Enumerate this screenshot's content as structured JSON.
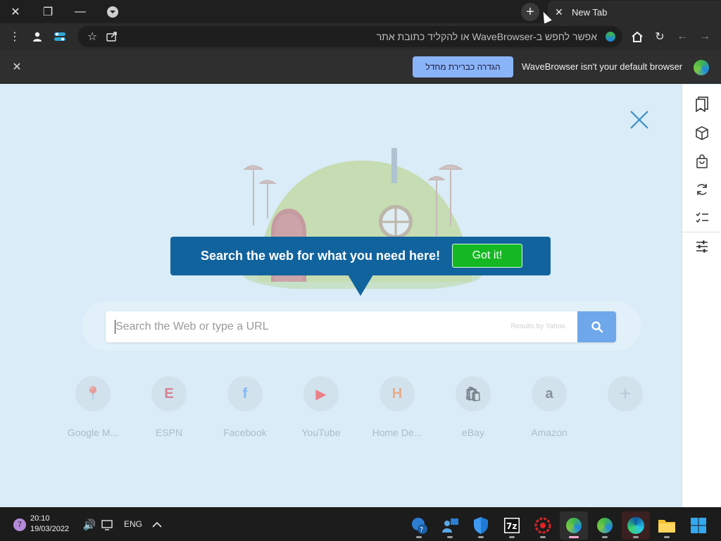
{
  "titlebar": {
    "tab_title": "New Tab"
  },
  "omnibox": {
    "placeholder": "אפשר לחפש ב-WaveBrowser או להקליד כתובת אתר"
  },
  "banner": {
    "message": "WaveBrowser isn't your default browser",
    "button_label": "הגדרה כברירת מחדל"
  },
  "tooltip": {
    "text": "Search the web for what you need here!",
    "button_label": "Got it!"
  },
  "search": {
    "placeholder": "Search the Web or type a URL",
    "powered_by": "Results by Yahoo"
  },
  "shortcuts": [
    {
      "label": "Google M...",
      "glyph": "📍",
      "color": "#e8b100"
    },
    {
      "label": "ESPN",
      "glyph": "E",
      "color": "#d0001b"
    },
    {
      "label": "Facebook",
      "glyph": "f",
      "color": "#1877f2"
    },
    {
      "label": "YouTube",
      "glyph": "▶",
      "color": "#ff0000"
    },
    {
      "label": "Home De...",
      "glyph": "H",
      "color": "#f96302"
    },
    {
      "label": "eBay",
      "glyph": "🛍",
      "color": "#3465cc"
    },
    {
      "label": "Amazon",
      "glyph": "a",
      "color": "#222222"
    },
    {
      "label": "",
      "glyph": "+",
      "color": "#8aa0ae"
    }
  ],
  "taskbar": {
    "badge": "7",
    "time": "20:10",
    "date": "19/03/2022",
    "language": "ENG"
  },
  "colors": {
    "page_bg": "#d9ecf7",
    "tooltip_bg": "#11639e",
    "gotit_bg": "#15b823",
    "banner_button_bg": "#8ab4f8",
    "search_button_bg": "#6ea8ea"
  }
}
